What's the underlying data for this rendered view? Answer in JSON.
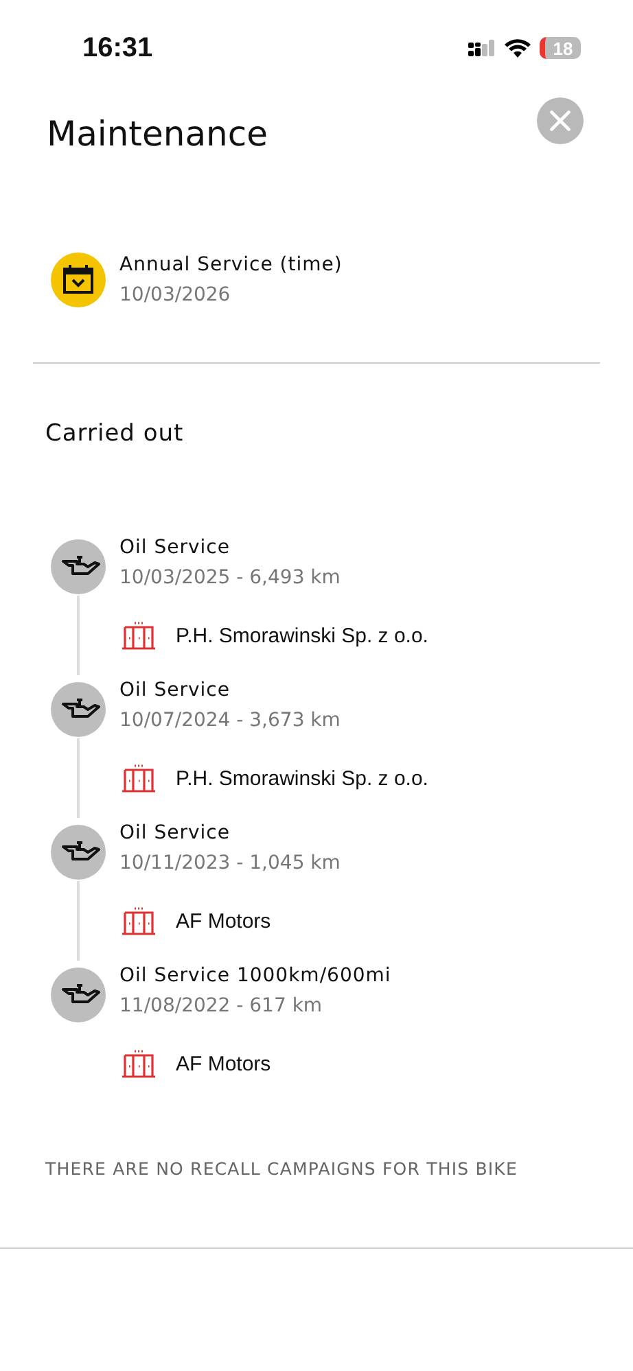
{
  "status_bar": {
    "time": "16:31",
    "battery": "18"
  },
  "header": {
    "title": "Maintenance"
  },
  "upcoming": [
    {
      "title": "Annual Service (time)",
      "date": "10/03/2026"
    }
  ],
  "carried_out": {
    "heading": "Carried out",
    "items": [
      {
        "title": "Oil Service",
        "detail": "10/03/2025 - 6,493 km",
        "dealer": "P.H. Smorawinski Sp. z o.o."
      },
      {
        "title": "Oil Service",
        "detail": "10/07/2024 - 3,673 km",
        "dealer": "P.H. Smorawinski Sp. z o.o."
      },
      {
        "title": "Oil Service",
        "detail": "10/11/2023 - 1,045 km",
        "dealer": "AF Motors"
      },
      {
        "title": "Oil Service 1000km/600mi",
        "detail": "11/08/2022 - 617 km",
        "dealer": "AF Motors"
      }
    ]
  },
  "recall_note": "THERE ARE NO RECALL CAMPAIGNS FOR THIS BIKE"
}
